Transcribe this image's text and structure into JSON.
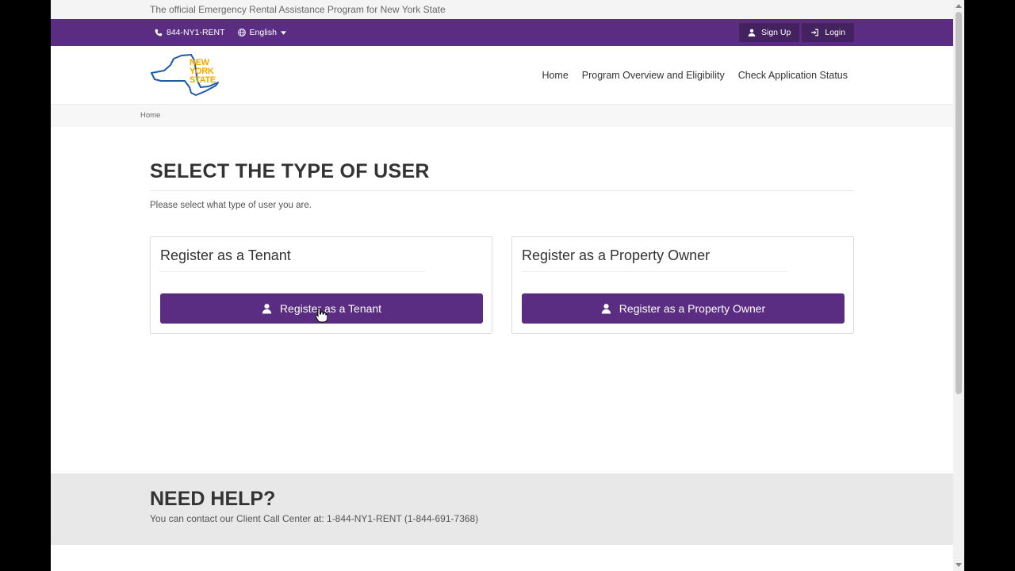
{
  "announce": "The official Emergency Rental Assistance Program for New York State",
  "utility": {
    "phone": "844-NY1-RENT",
    "language": "English",
    "signup": "Sign Up",
    "login": "Login"
  },
  "logo": {
    "line1": "NEW",
    "line2": "YORK",
    "line3": "STATE"
  },
  "nav": {
    "home": "Home",
    "overview": "Program Overview and Eligibility",
    "status": "Check Application Status"
  },
  "breadcrumb": "Home",
  "main": {
    "title": "SELECT THE TYPE OF USER",
    "subtitle": "Please select what type of user you are."
  },
  "cards": {
    "tenant": {
      "title": "Register as a Tenant",
      "button": "Register as a Tenant"
    },
    "owner": {
      "title": "Register as a Property Owner",
      "button": "Register as a Property Owner"
    }
  },
  "help": {
    "title": "NEED HELP?",
    "text": "You can contact our Client Call Center at: 1-844-NY1-RENT (1-844-691-7368)"
  },
  "colors": {
    "brand_purple": "#5b2d82",
    "dark_purple": "#44215f",
    "logo_gold": "#f2a900",
    "logo_blue": "#1e5aa8"
  }
}
